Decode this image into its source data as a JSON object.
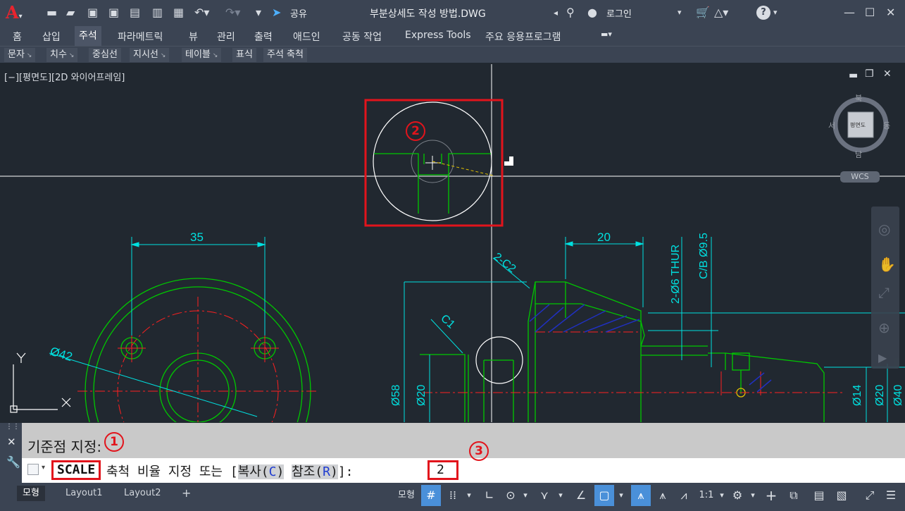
{
  "titlebar": {
    "share": "공유",
    "title": "부분상세도 작성 방법.DWG",
    "login": "로그인"
  },
  "ribbon": {
    "tabs": [
      "홈",
      "삽입",
      "주석",
      "파라메트릭",
      "뷰",
      "관리",
      "출력",
      "애드인",
      "공동 작업",
      "Express Tools",
      "주요 응용프로그램"
    ],
    "active_tab": "주석",
    "panels": [
      "문자",
      "치수",
      "중심선",
      "지시선",
      "테이블",
      "표식",
      "주석 축척"
    ]
  },
  "viewport": {
    "label": "[−][평면도][2D 와이어프레임]",
    "viewcube": {
      "n": "북",
      "s": "남",
      "e": "동",
      "w": "서",
      "face": "평면도"
    },
    "wcs": "WCS",
    "ucs_x": "X",
    "ucs_y": "Y"
  },
  "drawing": {
    "dims": {
      "d35": "35",
      "d20": "20",
      "d42": "Ø42",
      "c2": "2-C2",
      "c1": "C1",
      "thur": "2-Ø6 THUR",
      "cb": "C/B Ø9.5",
      "d58": "Ø58",
      "d20v": "Ø20",
      "d14": "Ø14",
      "d20r": "Ø20",
      "d40": "Ø40"
    },
    "colors": {
      "green": "#00c800",
      "cyan": "#00e0e0",
      "red": "#ff2020",
      "white": "#ffffff",
      "hatch": "#2030c0"
    }
  },
  "callouts": {
    "one": "1",
    "two": "2",
    "three": "3"
  },
  "command": {
    "history": "기준점 지정:",
    "name": "SCALE",
    "prompt_pre": "축척 비율 지정 또는 [",
    "opt1": "복사(",
    "opt1_key": "C",
    "opt1_end": ")",
    "opt2": "참조(",
    "opt2_key": "R",
    "opt2_end": ")",
    "prompt_post": "]:",
    "value": "2"
  },
  "status": {
    "tabs": [
      "모형",
      "Layout1",
      "Layout2"
    ],
    "model": "모형",
    "scale": "1:1"
  }
}
